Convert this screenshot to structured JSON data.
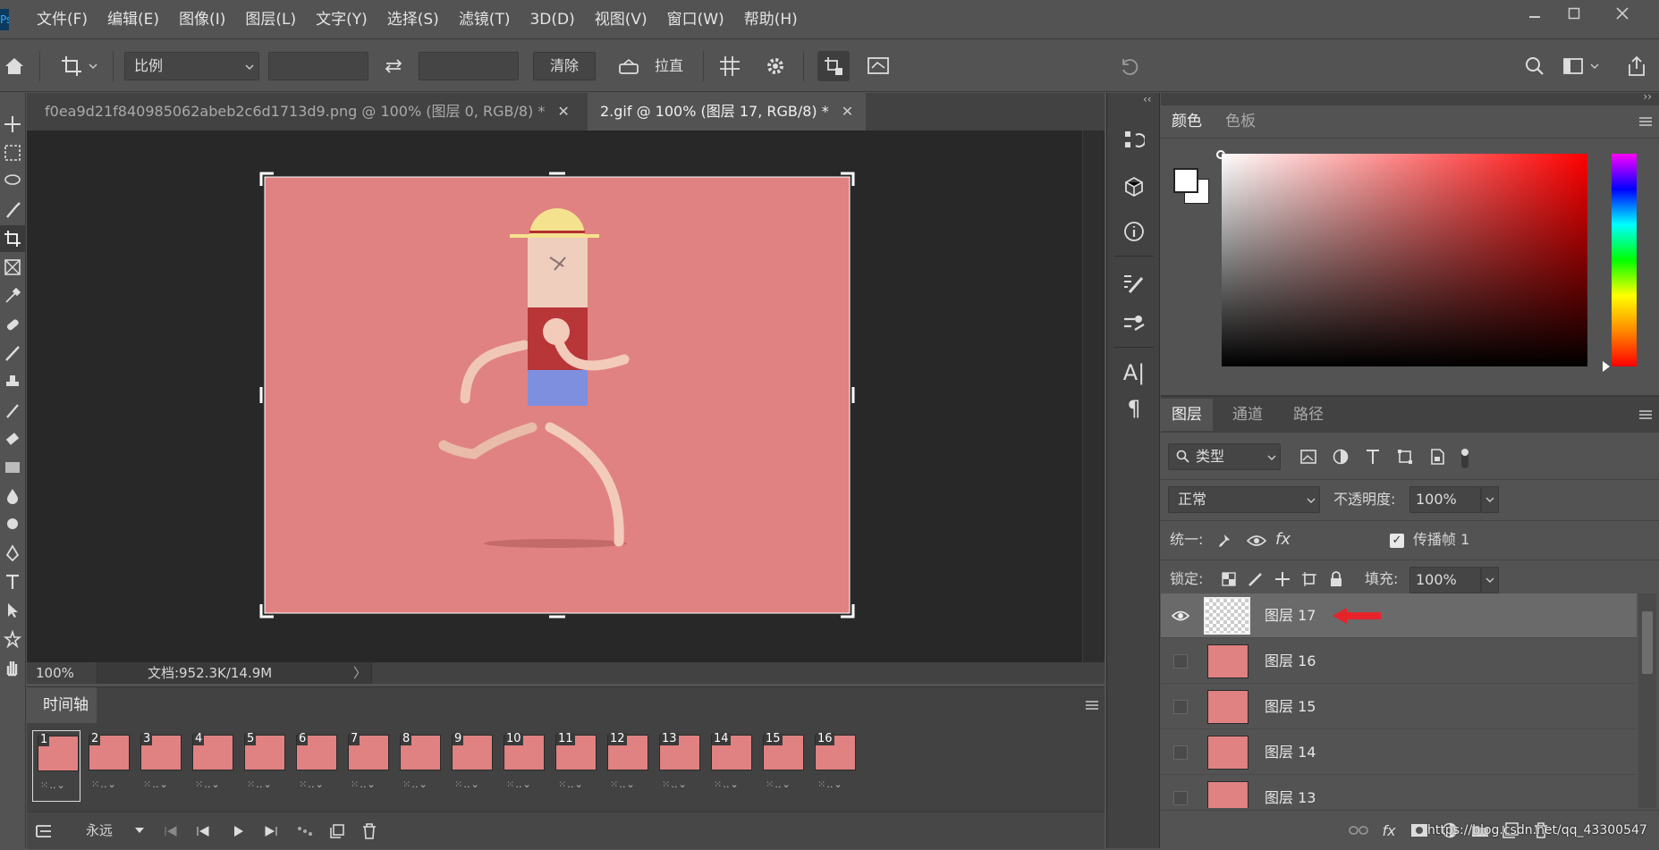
{
  "app": {
    "logo": "Ps"
  },
  "menu": [
    "文件(F)",
    "编辑(E)",
    "图像(I)",
    "图层(L)",
    "文字(Y)",
    "选择(S)",
    "滤镜(T)",
    "3D(D)",
    "视图(V)",
    "窗口(W)",
    "帮助(H)"
  ],
  "options": {
    "ratio_select": "比例",
    "clear_button": "清除",
    "straighten_label": "拉直"
  },
  "tabs": [
    {
      "label": "f0ea9d21f840985062abeb2c6d1713d9.png @ 100% (图层 0, RGB/8) *",
      "active": false
    },
    {
      "label": "2.gif @ 100% (图层 17, RGB/8) *",
      "active": true
    }
  ],
  "status": {
    "zoom": "100%",
    "doc": "文档:952.3K/14.9M"
  },
  "timeline": {
    "title": "时间轴",
    "frames": [
      "1",
      "2",
      "3",
      "4",
      "5",
      "6",
      "7",
      "8",
      "9",
      "10",
      "11",
      "12",
      "13",
      "14",
      "15",
      "16"
    ],
    "loop": "永远"
  },
  "color_panel": {
    "tabs": [
      "颜色",
      "色板"
    ]
  },
  "layers_panel": {
    "tabs": [
      "图层",
      "通道",
      "路径"
    ],
    "filter": "类型",
    "blend_mode": "正常",
    "opacity_label": "不透明度:",
    "opacity": "100%",
    "unify_label": "统一:",
    "propagate_label": "传播帧 1",
    "lock_label": "锁定:",
    "fill_label": "填充:",
    "fill": "100%",
    "layers": [
      {
        "name": "图层 17",
        "selected": true,
        "visible": true
      },
      {
        "name": "图层 16",
        "selected": false,
        "visible": false
      },
      {
        "name": "图层 15",
        "selected": false,
        "visible": false
      },
      {
        "name": "图层 14",
        "selected": false,
        "visible": false
      },
      {
        "name": "图层 13",
        "selected": false,
        "visible": false
      }
    ],
    "watermark": "https://blog.csdn.net/qq_43300547"
  },
  "colors": {
    "canvas_bg": "#e08281",
    "accent_arrow": "#e8222a",
    "ui_bg": "#535353"
  }
}
